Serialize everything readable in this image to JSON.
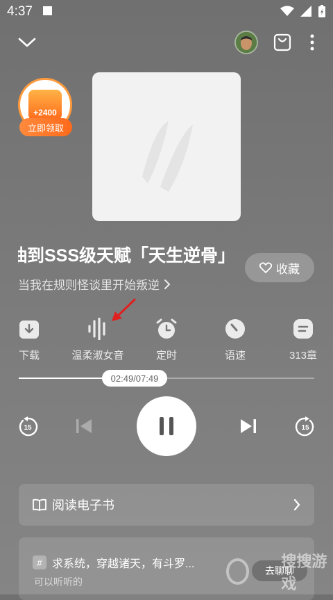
{
  "status_bar": {
    "time": "4:37"
  },
  "promo": {
    "amount": "+2400",
    "label": "立即领取"
  },
  "book": {
    "title": "抽到SSS级天赋「天生逆骨」",
    "subtitle": "当我在规则怪谈里开始叛逆",
    "favorite_label": "收藏"
  },
  "functions": [
    {
      "label": "下载"
    },
    {
      "label": "温柔淑女音"
    },
    {
      "label": "定时"
    },
    {
      "label": "语速"
    },
    {
      "label": "313章"
    }
  ],
  "player": {
    "time_display": "02:49/07:49",
    "progress": 0.36,
    "rewind_seconds": "15",
    "forward_seconds": "15"
  },
  "read_card": {
    "label": "阅读电子书"
  },
  "recommend": {
    "hash": "#",
    "title": "求系统，穿越诸天，有斗罗...",
    "subtitle": "可以听听的",
    "chat_label": "去聊聊"
  },
  "watermark": {
    "text": "搜搜游戏"
  },
  "colors": {
    "accent": "#ff6a1a",
    "background": "#777777"
  }
}
